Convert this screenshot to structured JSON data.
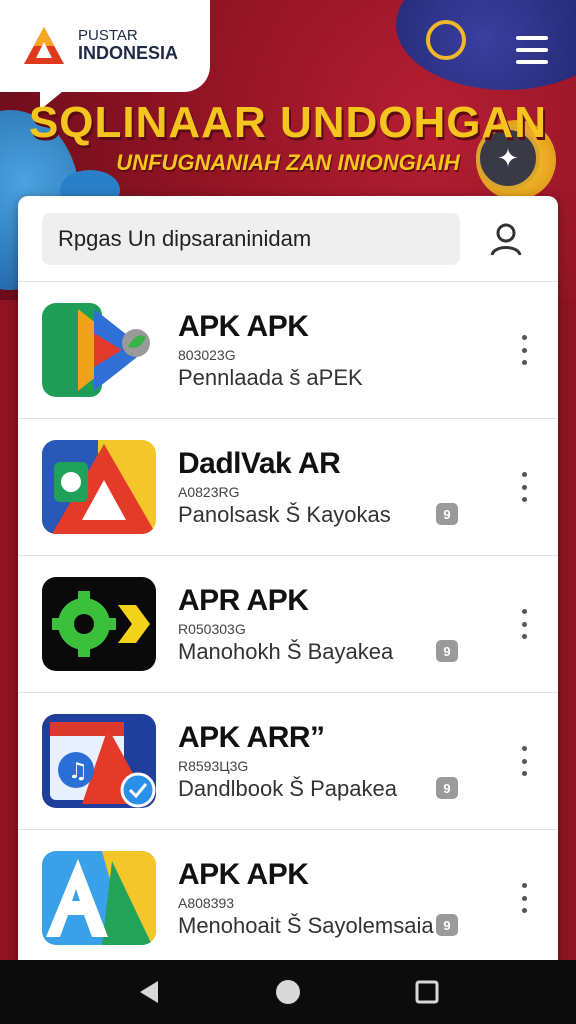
{
  "brand": {
    "line1": "PUSTAR",
    "line2": "INDONESIA"
  },
  "banner": {
    "headline": "SQLINAAR UNDOHGAN",
    "subline": "UNFUGNANIAH ZAN INIONGIAIH"
  },
  "search": {
    "value": "Rpgas Un dipsaraninidam"
  },
  "apps": [
    {
      "name": "APK APK",
      "code": "803023G",
      "desc": "Pennlaada š aPEK",
      "badge": "",
      "icon": "play-arrow-icon"
    },
    {
      "name": "DadlVak AR",
      "code": "A0823RG",
      "desc": "Panolsask Š Kayokas",
      "badge": "9",
      "icon": "a-arrow-icon"
    },
    {
      "name": "APR APK",
      "code": "R050303G",
      "desc": "Manohokh Š Bayakea",
      "badge": "9",
      "icon": "gear-arrow-icon"
    },
    {
      "name": "APK ARR”",
      "code": "R8593Ц3G",
      "desc": "Dandlbook Š Papakea",
      "badge": "9",
      "icon": "music-a-icon"
    },
    {
      "name": "APK APK",
      "code": "A808393",
      "desc": "Menohoait Š Sayolemsaia",
      "badge": "9",
      "icon": "a-blue-icon"
    }
  ],
  "colors": {
    "banner_red": "#8e1323",
    "headline_yellow": "#f4c51e"
  }
}
